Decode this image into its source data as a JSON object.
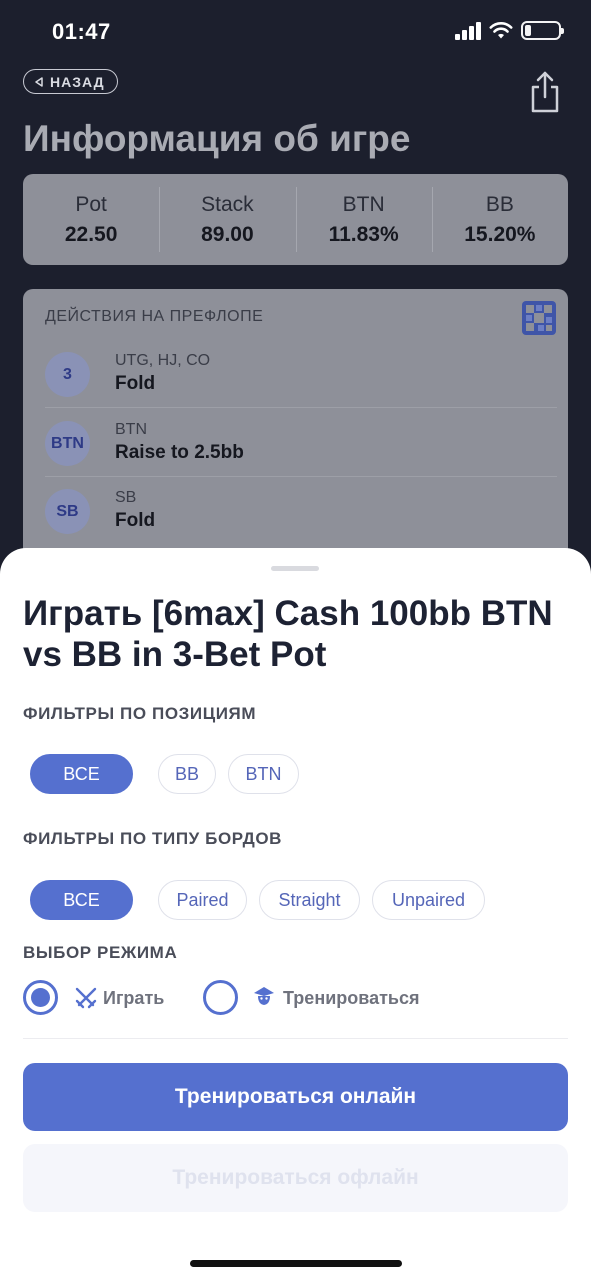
{
  "status_bar": {
    "time": "01:47"
  },
  "header": {
    "back_label": "НАЗАД",
    "title": "Информация об игре"
  },
  "stats": [
    {
      "label": "Pot",
      "value": "22.50"
    },
    {
      "label": "Stack",
      "value": "89.00"
    },
    {
      "label": "BTN",
      "value": "11.83%"
    },
    {
      "label": "BB",
      "value": "15.20%"
    }
  ],
  "preflop": {
    "title": "ДЕЙСТВИЯ НА ПРЕФЛОПЕ",
    "actions": [
      {
        "badge": "3",
        "positions": "UTG, HJ, CO",
        "action": "Fold"
      },
      {
        "badge": "BTN",
        "positions": "BTN",
        "action": "Raise to 2.5bb"
      },
      {
        "badge": "SB",
        "positions": "SB",
        "action": "Fold"
      }
    ]
  },
  "sheet": {
    "title": "Играть [6max] Cash 100bb BTN vs BB in 3-Bet Pot",
    "position_filters": {
      "label": "ФИЛЬТРЫ ПО ПОЗИЦИЯМ",
      "options": [
        "ВСЕ",
        "BB",
        "BTN"
      ],
      "selected": "ВСЕ"
    },
    "board_filters": {
      "label": "ФИЛЬТРЫ ПО ТИПУ БОРДОВ",
      "options": [
        "ВСЕ",
        "Paired",
        "Straight",
        "Unpaired"
      ],
      "selected": "ВСЕ"
    },
    "mode": {
      "label": "ВЫБОР РЕЖИМА",
      "options": [
        {
          "label": "Играть",
          "icon": "crossed-swords-icon",
          "selected": true
        },
        {
          "label": "Тренироваться",
          "icon": "trainer-icon",
          "selected": false
        }
      ]
    },
    "primary_button": "Тренироваться онлайн",
    "secondary_button": "Тренироваться офлайн"
  },
  "colors": {
    "accent": "#5570cf",
    "background_dark": "#1c1f2d",
    "sheet_background": "#ffffff"
  }
}
